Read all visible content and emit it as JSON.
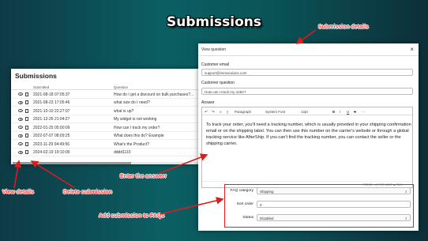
{
  "title": "Submissions",
  "callouts": {
    "submission_details": "Submission details",
    "enter_answer": "Enter the answerr",
    "view_details": "View details",
    "delete_submission": "Delete submission",
    "add_to_faqs": "Add submission to FAQs"
  },
  "submissions": {
    "title": "Submissions",
    "col_submitted": "Submitted",
    "col_question": "Question",
    "rows": [
      {
        "date": "2021-08-18 07:05:37",
        "question": "How do I get a discount on bulk purchases?..."
      },
      {
        "date": "2021-08-23 17:05:46",
        "question": "what size do I need?"
      },
      {
        "date": "2021-10-10 22:27:07",
        "question": "what is up?"
      },
      {
        "date": "2021-12-26 21:04:27",
        "question": "My widget is not working"
      },
      {
        "date": "2022-01-25 05:00:09",
        "question": "How can I track my order?"
      },
      {
        "date": "2022-07-07 08:09:25",
        "question": "What does this do? Example"
      },
      {
        "date": "2023-11-29 04:49:56",
        "question": "What's the Product?"
      },
      {
        "date": "2024-02-19 19:10:09",
        "question": "dddd1110"
      }
    ]
  },
  "modal": {
    "title": "View question",
    "close": "×",
    "email_label": "Customer email",
    "email_value": "support@immaculace.com",
    "question_label": "Customer question",
    "question_value": "How can I track my order?",
    "answer_label": "Answer",
    "toolbar": {
      "paragraph": "Paragraph",
      "font": "System Font",
      "size": "12pt"
    },
    "answer_text": "To track your order, you'll need a tracking number, which is usually provided in your shipping confirmation email or on the shipping label. You can then use this number on the carrier's website or through a global tracking service like AfterShip. If you can't find the tracking number, you can contact the seller or the shipping carrier.",
    "statusbar": "PRESS ⌥0 FOR HELP   ▲ TINY",
    "faq_category_label": "FAQ category",
    "faq_category_value": "Shipping",
    "sort_order_label": "Sort order",
    "sort_order_value": "0",
    "status_label": "Status",
    "status_value": "Disabled"
  },
  "colors": {
    "callout": "#ff3b3b",
    "arrow": "#d81e1e"
  }
}
